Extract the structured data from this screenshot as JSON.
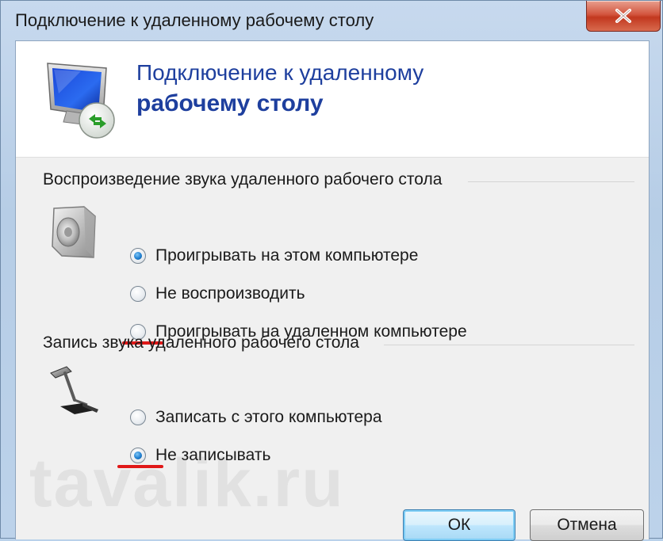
{
  "window": {
    "title": "Подключение к удаленному рабочему столу"
  },
  "header": {
    "line1": "Подключение к удаленному",
    "line2": "рабочему столу"
  },
  "playback": {
    "label": "Воспроизведение звука удаленного рабочего стола",
    "icon": "speaker-icon",
    "options": [
      {
        "label": "Проигрывать на этом компьютере",
        "selected": true
      },
      {
        "label": "Не воспроизводить",
        "selected": false
      },
      {
        "label": "Проигрывать на удаленном компьютере",
        "selected": false
      }
    ]
  },
  "recording": {
    "label": "Запись звука удаленного рабочего стола",
    "icon": "microphone-icon",
    "options": [
      {
        "label": "Записать с этого компьютера",
        "selected": false
      },
      {
        "label": "Не записывать",
        "selected": true
      }
    ]
  },
  "buttons": {
    "ok": "ОК",
    "cancel": "Отмена"
  },
  "watermark": "tavalik.ru",
  "colors": {
    "header_text": "#1e3f9e",
    "annotation_red": "#e01818",
    "close_button": "#c2381f"
  }
}
